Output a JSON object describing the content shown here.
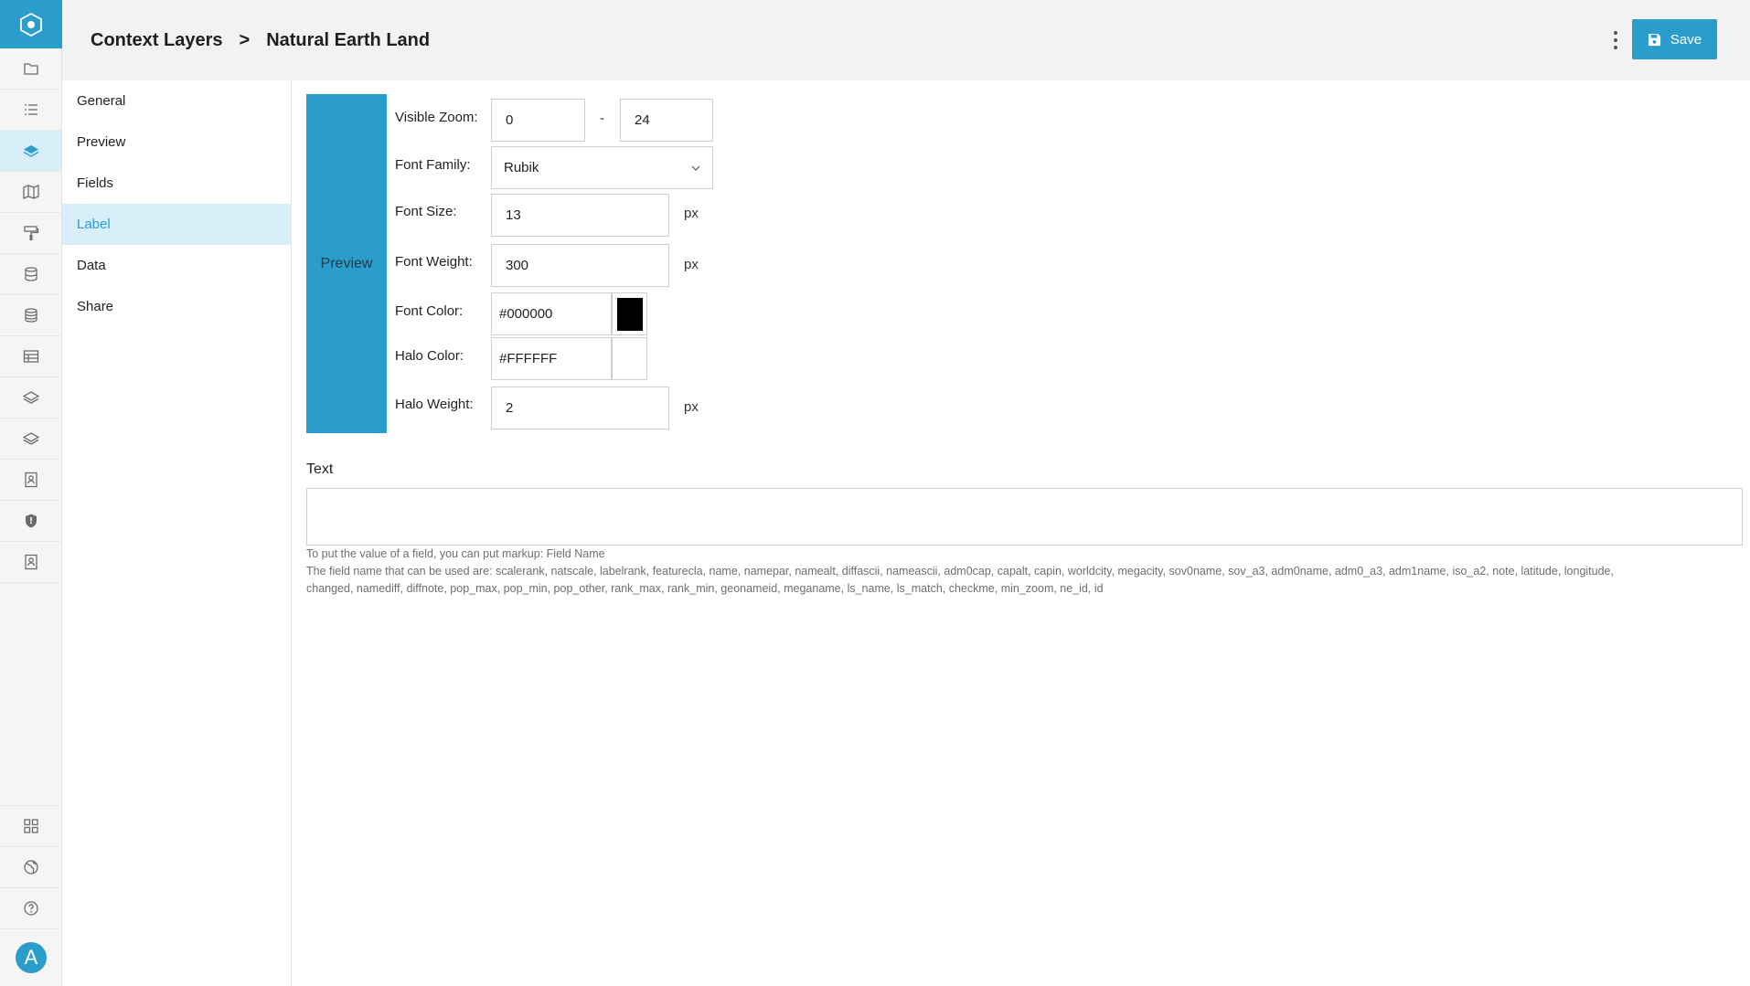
{
  "header": {
    "breadcrumb_root": "Context Layers",
    "breadcrumb_separator": ">",
    "breadcrumb_current": "Natural Earth Land",
    "save_label": "Save"
  },
  "rail": {
    "items": [
      "folder-icon",
      "list-icon",
      "layers-icon",
      "map-icon",
      "paint-roller-icon",
      "database-icon",
      "database-stack-icon",
      "table-icon",
      "layer-outline-icon",
      "layer-outline-2-icon",
      "contact-card-icon",
      "shield-icon",
      "contact-card-2-icon"
    ],
    "active": "layers-icon",
    "bottom": [
      "grid-icon",
      "globe-icon",
      "help-icon"
    ],
    "avatar_letter": "A"
  },
  "subnav": {
    "items": [
      {
        "label": "General"
      },
      {
        "label": "Preview"
      },
      {
        "label": "Fields"
      },
      {
        "label": "Label"
      },
      {
        "label": "Data"
      },
      {
        "label": "Share"
      }
    ],
    "active": "Label"
  },
  "form": {
    "preview_label": "Preview",
    "visible_zoom_label": "Visible Zoom:",
    "zoom_min": "0",
    "zoom_separator": "-",
    "zoom_max": "24",
    "font_family_label": "Font Family:",
    "font_family_value": "Rubik",
    "font_size_label": "Font Size:",
    "font_size_value": "13",
    "font_weight_label": "Font Weight:",
    "font_weight_value": "300",
    "unit_px": "px",
    "font_color_label": "Font Color:",
    "font_color_value": "#000000",
    "halo_color_label": "Halo Color:",
    "halo_color_value": "#FFFFFF",
    "halo_weight_label": "Halo Weight:",
    "halo_weight_value": "2",
    "text_label": "Text",
    "text_value": "",
    "hint_line1": "To put the value of a field, you can put markup: Field Name",
    "hint_line2": "The field name that can be used are: scalerank, natscale, labelrank, featurecla, name, namepar, namealt, diffascii, nameascii, adm0cap, capalt, capin, worldcity, megacity, sov0name, sov_a3, adm0name, adm0_a3, adm1name, iso_a2, note, latitude, longitude,",
    "hint_line3": "changed, namediff, diffnote, pop_max, pop_min, pop_other, rank_max, rank_min, geonameid, meganame, ls_name, ls_match, checkme, min_zoom, ne_id, id"
  },
  "colors": {
    "accent": "#2a9dcc",
    "active_bg": "#d8eef8"
  }
}
